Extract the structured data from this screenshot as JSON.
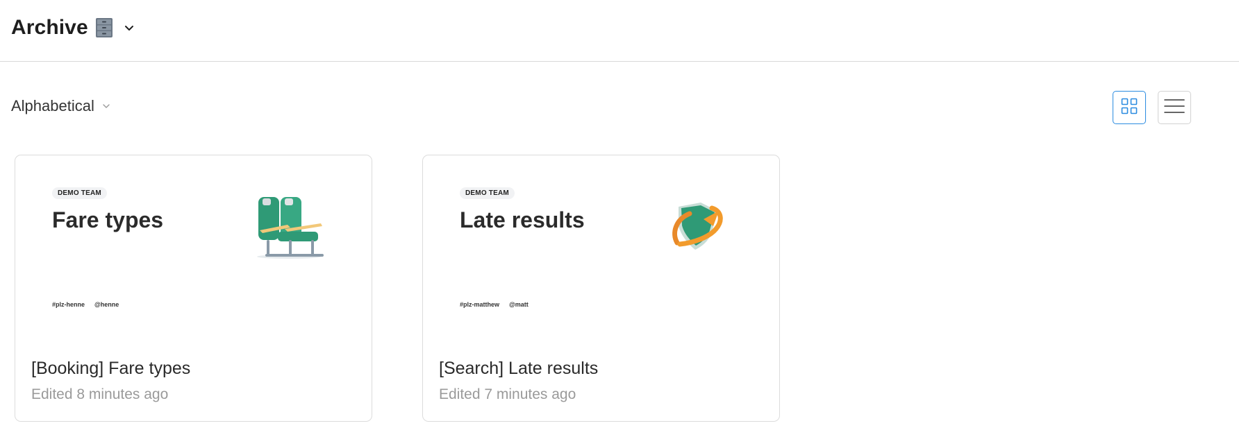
{
  "header": {
    "title": "Archive",
    "emoji_icon": "file-cabinet-icon",
    "dropdown_icon": "chevron-down-icon"
  },
  "toolbar": {
    "sort_label": "Alphabetical",
    "sort_icon": "chevron-down-icon",
    "views": [
      {
        "name": "grid-view",
        "icon": "grid-icon",
        "selected": true
      },
      {
        "name": "list-view",
        "icon": "list-icon",
        "selected": false
      }
    ]
  },
  "colors": {
    "accent": "#2a8be0",
    "border": "#dcdcdc",
    "muted_text": "#9a9a9a",
    "illustration_green": "#2f9a76",
    "illustration_orange": "#f29b2c"
  },
  "cards": [
    {
      "name": "[Booking] Fare types",
      "meta": "Edited 8 minutes ago",
      "preview": {
        "team": "DEMO TEAM",
        "title": "Fare types",
        "channel": "#plz-henne",
        "handle": "@henne",
        "illustration": "airplane-seats-icon"
      }
    },
    {
      "name": "[Search] Late results",
      "meta": "Edited 7 minutes ago",
      "preview": {
        "team": "DEMO TEAM",
        "title": "Late results",
        "channel": "#plz-matthew",
        "handle": "@matt",
        "illustration": "shield-arrow-icon"
      }
    }
  ]
}
